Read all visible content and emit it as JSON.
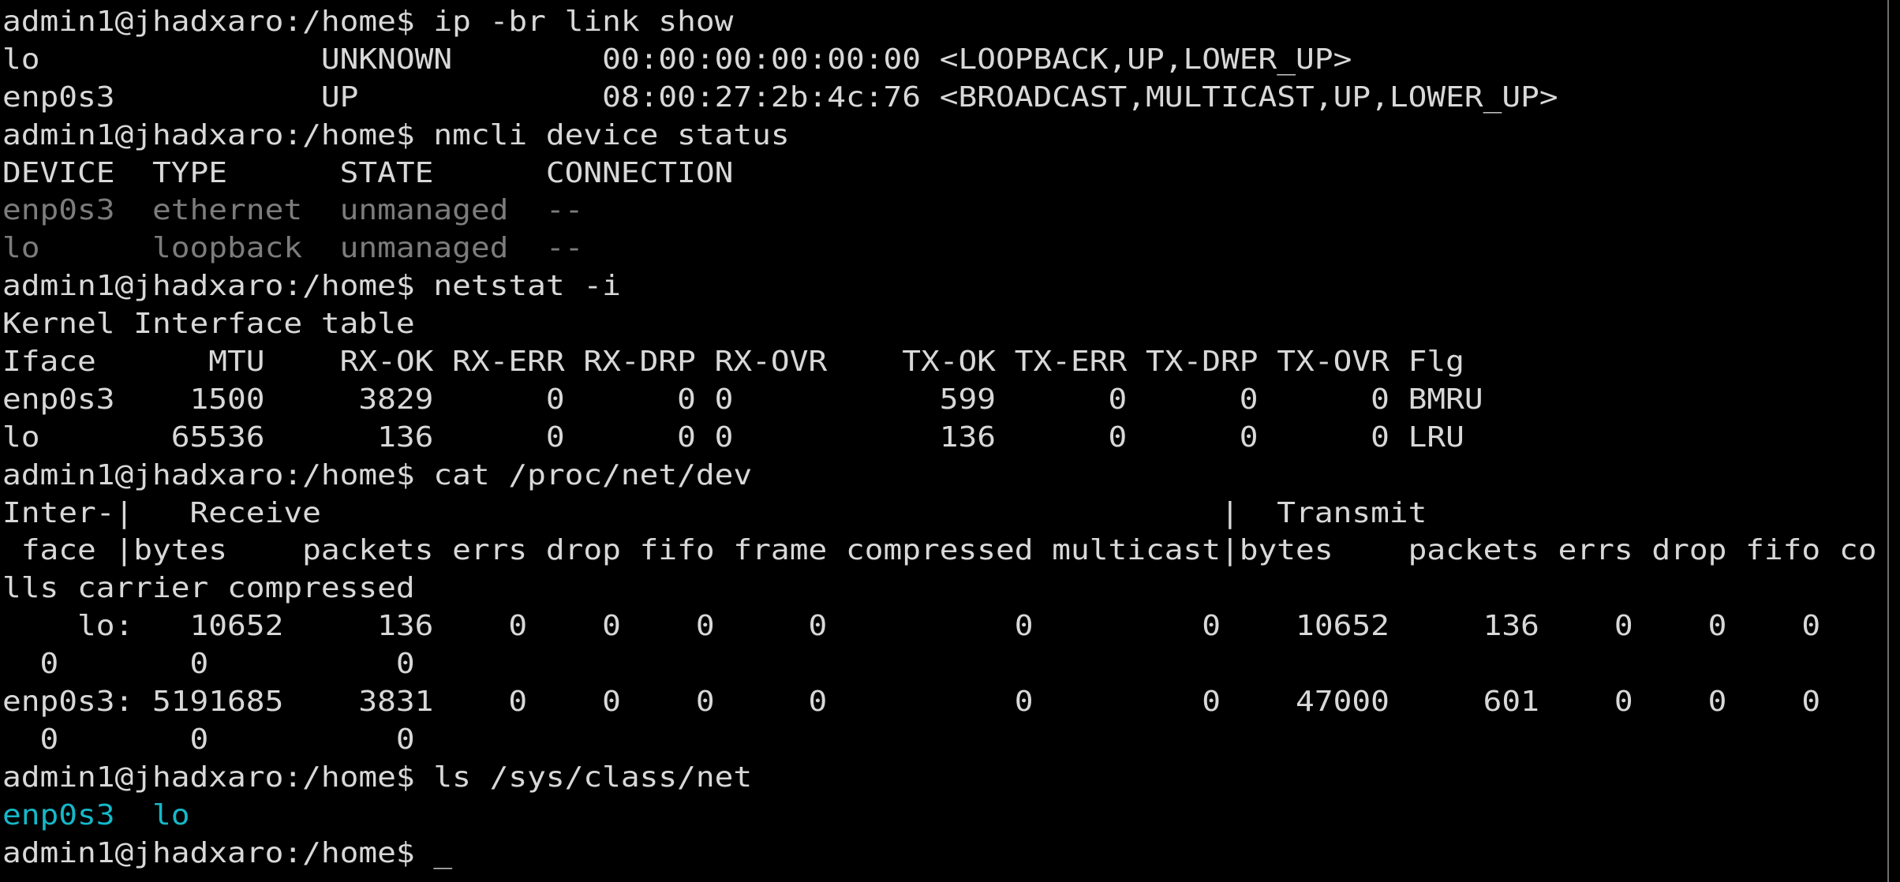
{
  "terminal": {
    "colors": {
      "background": "#000000",
      "foreground": "#d8d8d8",
      "dim": "#7c7c7c",
      "cyan": "#15b8c8"
    },
    "lines": [
      {
        "kind": "prompt",
        "text": "admin1@jhadxaro:/home$ ip -br link show"
      },
      {
        "kind": "output",
        "text": "lo               UNKNOWN        00:00:00:00:00:00 <LOOPBACK,UP,LOWER_UP>"
      },
      {
        "kind": "output",
        "text": "enp0s3           UP             08:00:27:2b:4c:76 <BROADCAST,MULTICAST,UP,LOWER_UP>"
      },
      {
        "kind": "prompt",
        "text": "admin1@jhadxaro:/home$ nmcli device status"
      },
      {
        "kind": "output",
        "text": "DEVICE  TYPE      STATE      CONNECTION"
      },
      {
        "kind": "dim",
        "text": "enp0s3  ethernet  unmanaged  --"
      },
      {
        "kind": "dim",
        "text": "lo      loopback  unmanaged  --"
      },
      {
        "kind": "prompt",
        "text": "admin1@jhadxaro:/home$ netstat -i"
      },
      {
        "kind": "output",
        "text": "Kernel Interface table"
      },
      {
        "kind": "output",
        "text": "Iface      MTU    RX-OK RX-ERR RX-DRP RX-OVR    TX-OK TX-ERR TX-DRP TX-OVR Flg"
      },
      {
        "kind": "output",
        "text": "enp0s3    1500     3829      0      0 0           599      0      0      0 BMRU"
      },
      {
        "kind": "output",
        "text": "lo       65536      136      0      0 0           136      0      0      0 LRU"
      },
      {
        "kind": "prompt",
        "text": "admin1@jhadxaro:/home$ cat /proc/net/dev"
      },
      {
        "kind": "output",
        "text": "Inter-|   Receive                                                |  Transmit"
      },
      {
        "kind": "output",
        "text": " face |bytes    packets errs drop fifo frame compressed multicast|bytes    packets errs drop fifo co"
      },
      {
        "kind": "output",
        "text": "lls carrier compressed"
      },
      {
        "kind": "output",
        "text": "    lo:   10652     136    0    0    0     0          0         0    10652     136    0    0    0"
      },
      {
        "kind": "output",
        "text": "  0       0          0"
      },
      {
        "kind": "output",
        "text": "enp0s3: 5191685    3831    0    0    0     0          0         0    47000     601    0    0    0"
      },
      {
        "kind": "output",
        "text": "  0       0          0"
      },
      {
        "kind": "prompt",
        "text": "admin1@jhadxaro:/home$ ls /sys/class/net"
      },
      {
        "kind": "listing",
        "items": [
          "enp0s3",
          "lo"
        ],
        "separator": "  "
      },
      {
        "kind": "prompt-active",
        "prompt": "admin1@jhadxaro:/home$ ",
        "cursor": "_"
      }
    ]
  }
}
